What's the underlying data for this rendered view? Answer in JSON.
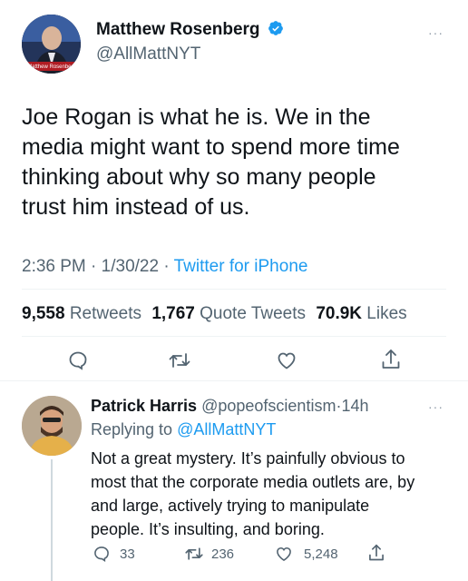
{
  "tweet": {
    "author_name": "Matthew Rosenberg",
    "author_handle": "@AllMattNYT",
    "verified": true,
    "text_lines": [
      "Joe Rogan is what he is. We in the",
      "media might want to spend more time",
      "thinking about why so many people",
      "trust him instead of us."
    ],
    "time": "2:36 PM",
    "date": "1/30/22",
    "source": "Twitter for iPhone",
    "separator": "·",
    "stats": {
      "retweets_count": "9,558",
      "retweets_label": "Retweets",
      "quotes_count": "1,767",
      "quotes_label": "Quote Tweets",
      "likes_count": "70.9K",
      "likes_label": "Likes"
    },
    "actions": [
      "reply-icon",
      "retweet-icon",
      "like-icon",
      "share-icon"
    ],
    "more": "···"
  },
  "reply": {
    "author_name": "Patrick Harris",
    "author_handle": "@popeofscientism",
    "time_ago": "14h",
    "separator": "·",
    "replying_prefix": "Replying to",
    "replying_to": "@AllMattNYT",
    "text_lines": [
      "Not a great mystery. It’s painfully obvious to",
      "most that the corporate media outlets are, by",
      "and large, actively trying to manipulate",
      "people. It’s insulting, and boring."
    ],
    "counts": {
      "replies": "33",
      "retweets": "236",
      "likes": "5,248"
    },
    "more": "···"
  },
  "colors": {
    "accent": "#1d9bf0",
    "secondary_text": "#536471",
    "divider": "#eff3f4"
  }
}
